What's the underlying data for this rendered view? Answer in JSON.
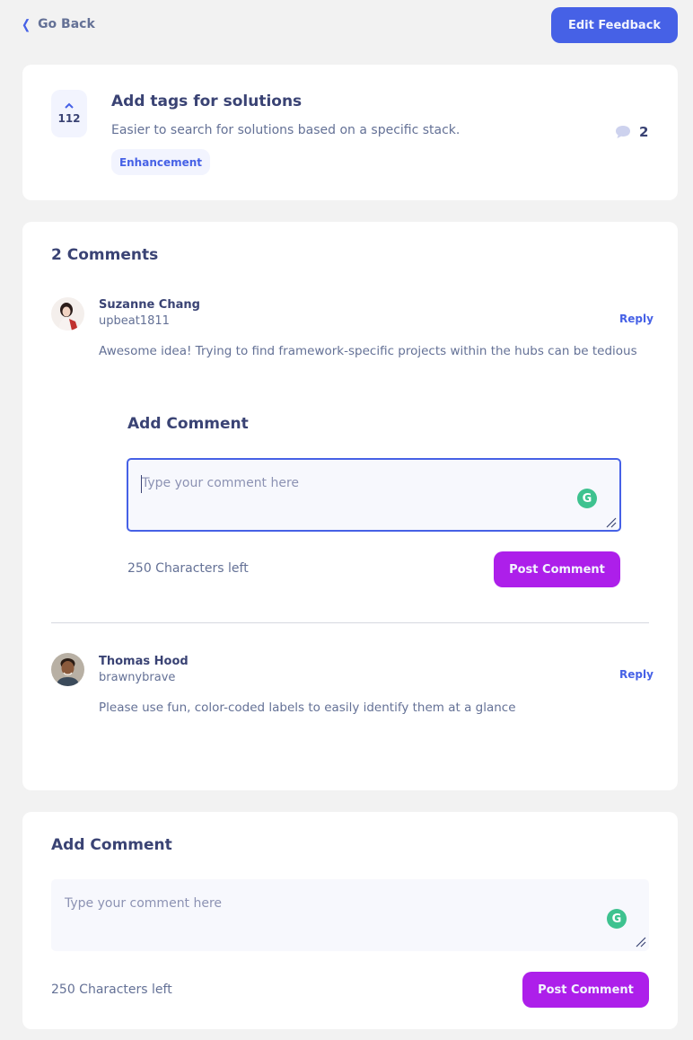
{
  "topbar": {
    "go_back": "Go Back",
    "edit_feedback": "Edit Feedback"
  },
  "feedback": {
    "upvotes": "112",
    "title": "Add tags for solutions",
    "description": "Easier to search for solutions based on a specific stack.",
    "tag": "Enhancement",
    "comment_count": "2"
  },
  "comments": {
    "heading": "2 Comments",
    "items": [
      {
        "name": "Suzanne Chang",
        "handle": "upbeat1811",
        "reply": "Reply",
        "text": "Awesome idea! Trying to find framework-specific projects within the hubs can be tedious"
      },
      {
        "name": "Thomas Hood",
        "handle": "brawnybrave",
        "reply": "Reply",
        "text": "Please use fun, color-coded labels to easily identify them at a glance"
      }
    ],
    "inline_reply": {
      "title": "Add Comment",
      "placeholder": "Type your comment here",
      "chars_left": "250 Characters left",
      "post_label": "Post Comment"
    }
  },
  "add_comment": {
    "title": "Add Comment",
    "placeholder": "Type your comment here",
    "chars_left": "250 Characters left",
    "post_label": "Post Comment"
  },
  "icons": {
    "back": "chevron-left-icon",
    "upvote": "chevron-up-icon",
    "comment": "speech-bubble-icon",
    "grammarly": "grammarly-icon",
    "resize": "resize-handle-icon"
  },
  "colors": {
    "primary": "#4661e6",
    "accent": "#ad1fea",
    "text": "#3a4374",
    "muted": "#647196"
  }
}
